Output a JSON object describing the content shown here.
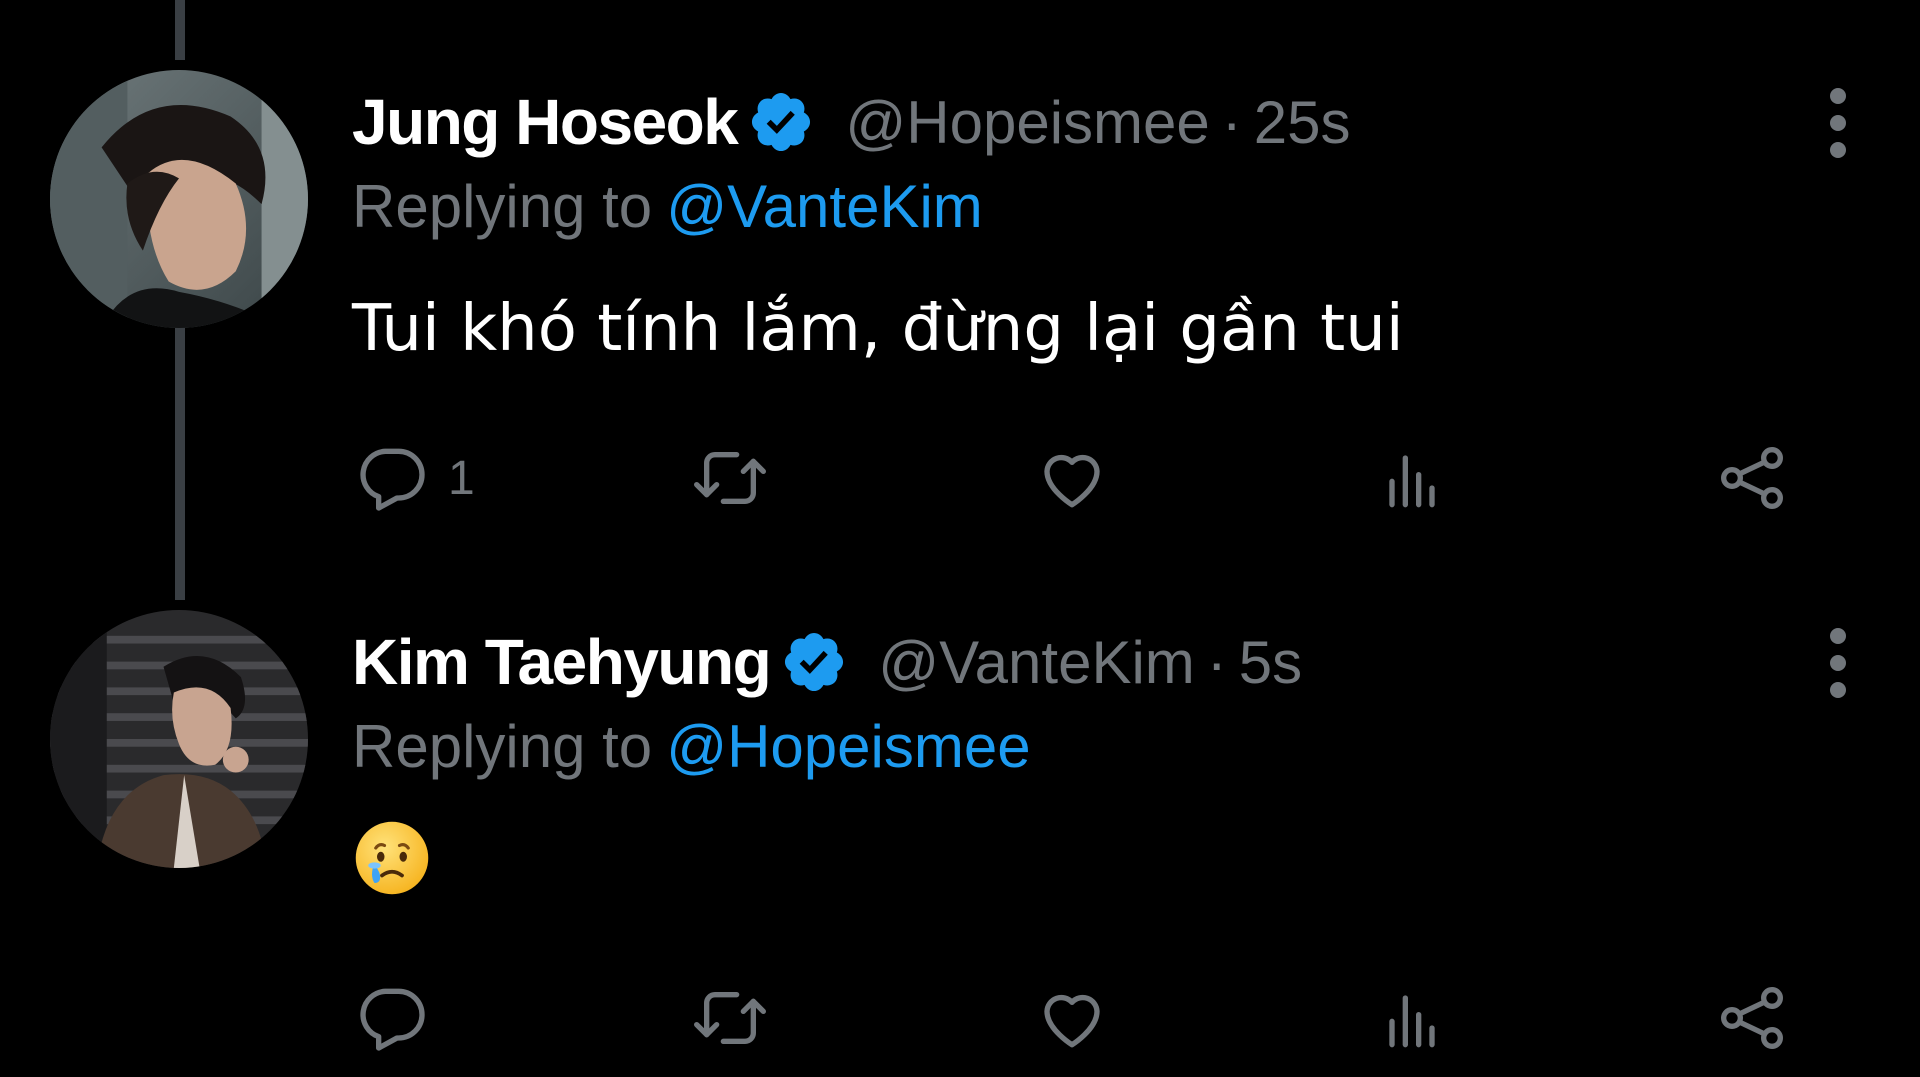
{
  "tweets": [
    {
      "display_name": "Jung Hoseok",
      "handle": "@Hopeisme e",
      "separator": "·",
      "time": "25s",
      "replying_prefix": "Replying to",
      "replying_to": "@VanteKim",
      "text": "Tui khó tính lắm, đừng lại gần tui",
      "reply_count": "1"
    },
    {
      "display_name": "Kim Taehyung",
      "handle": "@VanteKim",
      "separator": "·",
      "time": "5s",
      "replying_prefix": "Replying to",
      "replying_to": "@Hopeismee",
      "emoji": "face-holding-back-tears",
      "reply_count": ""
    }
  ],
  "icons": {
    "verified": "verified-badge-icon",
    "more": "more-options-icon",
    "reply": "reply-icon",
    "retweet": "retweet-icon",
    "like": "heart-icon",
    "views": "views-icon",
    "share": "share-icon"
  },
  "colors": {
    "background": "#000000",
    "accent": "#1d9bf0",
    "muted": "#71767b",
    "text": "#ffffff",
    "thread_line": "#3a3f44"
  }
}
